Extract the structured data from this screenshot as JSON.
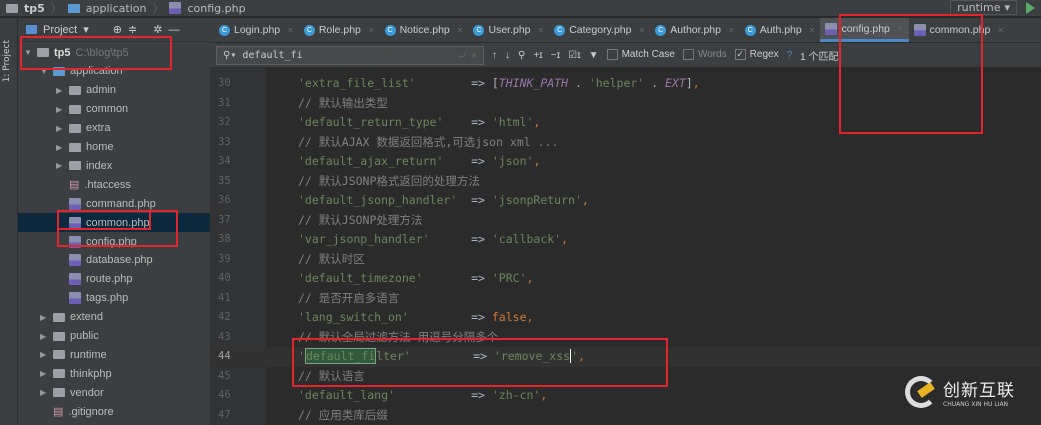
{
  "breadcrumb": [
    "tp5",
    "application",
    "config.php"
  ],
  "run_config": "runtime",
  "sidebar_strip_label": "1: Project",
  "project": {
    "title": "Project",
    "tree": [
      {
        "label": "tp5",
        "path": "C:\\blog\\tp5",
        "depth": 0,
        "type": "folder",
        "open": true
      },
      {
        "label": "application",
        "depth": 1,
        "type": "folder",
        "open": true,
        "blue": true
      },
      {
        "label": "admin",
        "depth": 2,
        "type": "folder"
      },
      {
        "label": "common",
        "depth": 2,
        "type": "folder"
      },
      {
        "label": "extra",
        "depth": 2,
        "type": "folder"
      },
      {
        "label": "home",
        "depth": 2,
        "type": "folder"
      },
      {
        "label": "index",
        "depth": 2,
        "type": "folder"
      },
      {
        "label": ".htaccess",
        "depth": 2,
        "type": "file"
      },
      {
        "label": "command.php",
        "depth": 2,
        "type": "php"
      },
      {
        "label": "common.php",
        "depth": 2,
        "type": "php",
        "selected": true
      },
      {
        "label": "config.php",
        "depth": 2,
        "type": "php"
      },
      {
        "label": "database.php",
        "depth": 2,
        "type": "php"
      },
      {
        "label": "route.php",
        "depth": 2,
        "type": "php"
      },
      {
        "label": "tags.php",
        "depth": 2,
        "type": "php"
      },
      {
        "label": "extend",
        "depth": 1,
        "type": "folder"
      },
      {
        "label": "public",
        "depth": 1,
        "type": "folder"
      },
      {
        "label": "runtime",
        "depth": 1,
        "type": "folder"
      },
      {
        "label": "thinkphp",
        "depth": 1,
        "type": "folder"
      },
      {
        "label": "vendor",
        "depth": 1,
        "type": "folder"
      },
      {
        "label": ".gitignore",
        "depth": 1,
        "type": "file"
      }
    ]
  },
  "tabs": [
    {
      "label": "Login.php",
      "kind": "class"
    },
    {
      "label": "Role.php",
      "kind": "class"
    },
    {
      "label": "Notice.php",
      "kind": "class"
    },
    {
      "label": "User.php",
      "kind": "class"
    },
    {
      "label": "Category.php",
      "kind": "class"
    },
    {
      "label": "Author.php",
      "kind": "class"
    },
    {
      "label": "Auth.php",
      "kind": "class"
    },
    {
      "label": "config.php",
      "kind": "php",
      "active": true
    },
    {
      "label": "common.php",
      "kind": "php"
    }
  ],
  "search": {
    "value": "default_fi",
    "match_case": "Match Case",
    "words": "Words",
    "regex": "Regex",
    "regex_checked": true,
    "help": "?",
    "result": "1 个匹配"
  },
  "code": [
    {
      "n": "30",
      "t": [
        [
          "s",
          "'extra_file_list'"
        ],
        [
          "op",
          "        => ["
        ],
        [
          "i",
          "THINK_PATH"
        ],
        [
          "op",
          " . "
        ],
        [
          "s",
          "'helper'"
        ],
        [
          "op",
          " . "
        ],
        [
          "i",
          "EXT"
        ],
        [
          "op",
          "]"
        ],
        [
          "k",
          ","
        ]
      ]
    },
    {
      "n": "31",
      "t": [
        [
          "cm",
          "// 默认输出类型"
        ]
      ]
    },
    {
      "n": "32",
      "t": [
        [
          "s",
          "'default_return_type'"
        ],
        [
          "op",
          "    => "
        ],
        [
          "s",
          "'html'"
        ],
        [
          "k",
          ","
        ]
      ]
    },
    {
      "n": "33",
      "t": [
        [
          "cm",
          "// 默认AJAX 数据返回格式,可选json xml ..."
        ]
      ]
    },
    {
      "n": "34",
      "t": [
        [
          "s",
          "'default_ajax_return'"
        ],
        [
          "op",
          "    => "
        ],
        [
          "s",
          "'json'"
        ],
        [
          "k",
          ","
        ]
      ]
    },
    {
      "n": "35",
      "t": [
        [
          "cm",
          "// 默认JSONP格式返回的处理方法"
        ]
      ]
    },
    {
      "n": "36",
      "t": [
        [
          "s",
          "'default_jsonp_handler'"
        ],
        [
          "op",
          "  => "
        ],
        [
          "s",
          "'jsonpReturn'"
        ],
        [
          "k",
          ","
        ]
      ]
    },
    {
      "n": "37",
      "t": [
        [
          "cm",
          "// 默认JSONP处理方法"
        ]
      ]
    },
    {
      "n": "38",
      "t": [
        [
          "s",
          "'var_jsonp_handler'"
        ],
        [
          "op",
          "      => "
        ],
        [
          "s",
          "'callback'"
        ],
        [
          "k",
          ","
        ]
      ]
    },
    {
      "n": "39",
      "t": [
        [
          "cm",
          "// 默认时区"
        ]
      ]
    },
    {
      "n": "40",
      "t": [
        [
          "s",
          "'default_timezone'"
        ],
        [
          "op",
          "       => "
        ],
        [
          "s",
          "'PRC'"
        ],
        [
          "k",
          ","
        ]
      ]
    },
    {
      "n": "41",
      "t": [
        [
          "cm",
          "// 是否开启多语言"
        ]
      ]
    },
    {
      "n": "42",
      "t": [
        [
          "s",
          "'lang_switch_on'"
        ],
        [
          "op",
          "         => "
        ],
        [
          "k",
          "false,"
        ]
      ]
    },
    {
      "n": "43",
      "t": [
        [
          "cm",
          "// 默认全局过滤方法 用逗号分隔多个"
        ]
      ]
    },
    {
      "n": "44",
      "cur": true,
      "t": [
        [
          "s",
          "'"
        ],
        [
          "hl",
          "default_fi"
        ],
        [
          "s",
          "lter'"
        ],
        [
          "op",
          "         => "
        ],
        [
          "caret",
          "'remove_xss"
        ],
        [
          "s",
          "'"
        ],
        [
          "k",
          ","
        ]
      ]
    },
    {
      "n": "45",
      "t": [
        [
          "cm",
          "// 默认语言"
        ]
      ]
    },
    {
      "n": "46",
      "t": [
        [
          "s",
          "'default_lang'"
        ],
        [
          "op",
          "           => "
        ],
        [
          "s",
          "'zh-cn'"
        ],
        [
          "k",
          ","
        ]
      ]
    },
    {
      "n": "47",
      "t": [
        [
          "cm",
          "// 应用类库后缀"
        ]
      ]
    }
  ],
  "watermark": {
    "name": "创新互联",
    "pinyin": "CHUANG XIN HU LIAN"
  }
}
